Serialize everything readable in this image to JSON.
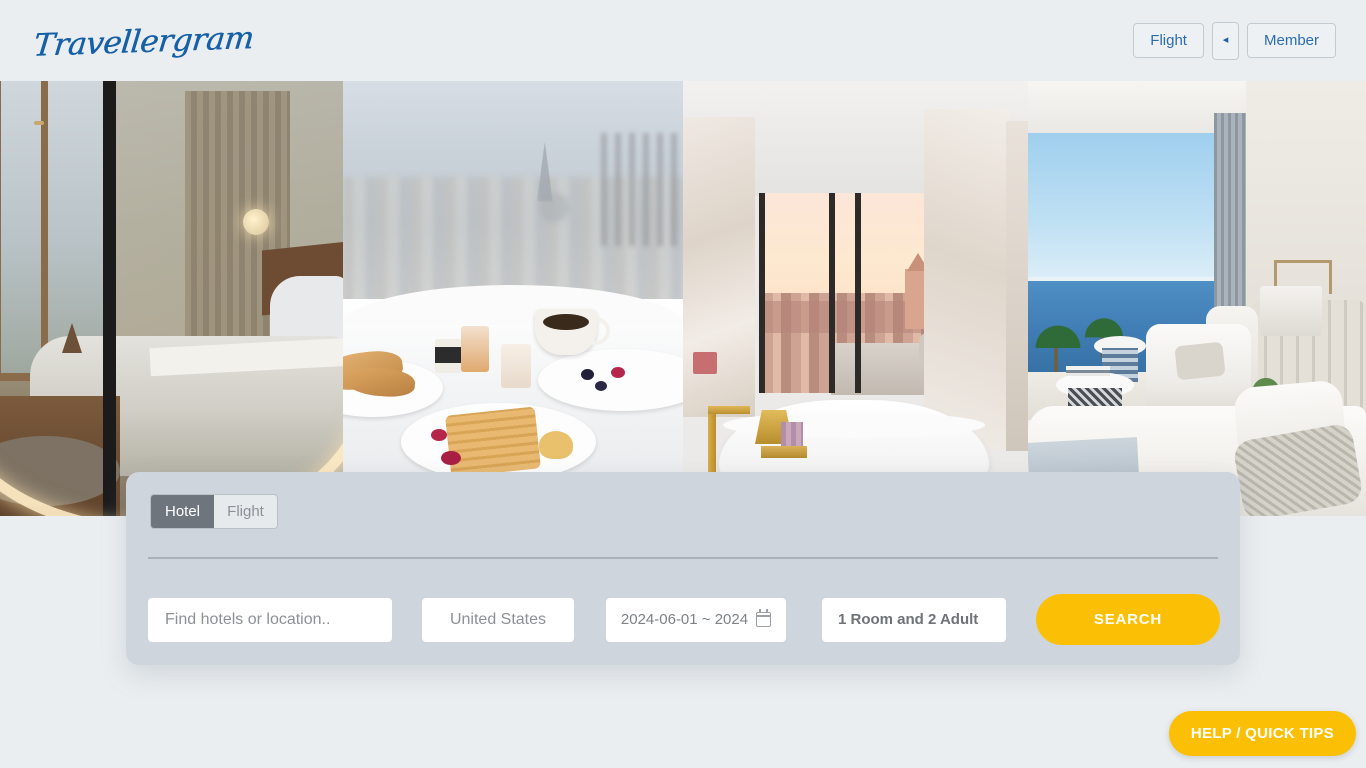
{
  "header": {
    "logo": "Travellergram",
    "buttons": [
      {
        "label": "Flight",
        "name": "flight-nav-button"
      },
      {
        "label": "◂",
        "name": "collapse-arrow-button"
      },
      {
        "label": "Member",
        "name": "member-button"
      }
    ],
    "flight_label": "Flight",
    "arrow_label": "◂",
    "member_label": "Member"
  },
  "hero": {
    "images": [
      {
        "alt": "hotel-bedroom-with-city-window"
      },
      {
        "alt": "breakfast-in-bed-with-city-view"
      },
      {
        "alt": "marble-bathroom-with-freestanding-tub"
      },
      {
        "alt": "ocean-view-suite-with-palm-trees"
      }
    ]
  },
  "search": {
    "tabs": [
      {
        "label": "Hotel",
        "active": true
      },
      {
        "label": "Flight",
        "active": false
      }
    ],
    "hotel_tab_label": "Hotel",
    "flight_tab_label": "Flight",
    "location_placeholder": "Find hotels or location..",
    "location_value": "",
    "country_value": "United States",
    "dates_value": "2024-06-01 ~ 2024",
    "guests_value": "1 Room and 2 Adult",
    "search_label": "SEARCH"
  },
  "help": {
    "label": "HELP / QUICK TIPS"
  },
  "colors": {
    "accent_yellow": "#fbc005",
    "brand_blue": "#1560a8",
    "panel_bg": "#ced5dc",
    "page_bg": "#eaeef1"
  }
}
